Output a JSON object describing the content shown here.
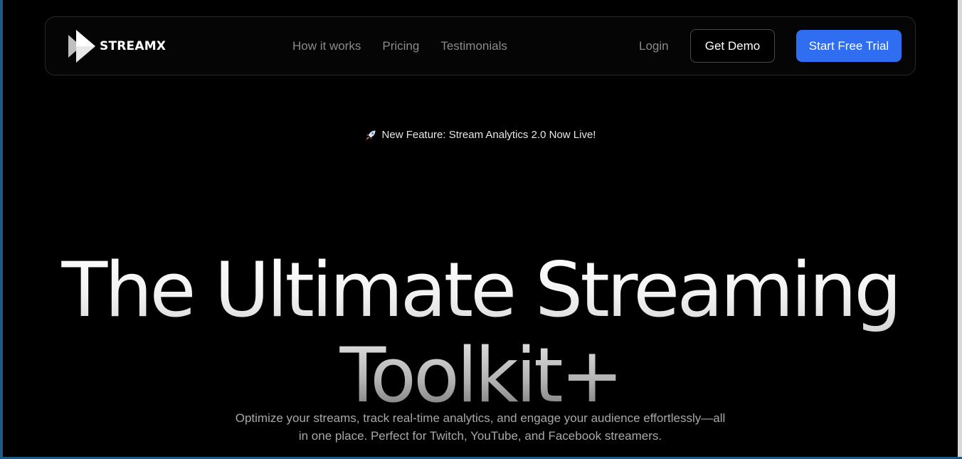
{
  "nav": {
    "brand": "STREAMX",
    "links": [
      "How it works",
      "Pricing",
      "Testimonials"
    ],
    "login": "Login",
    "demo_button": "Get Demo",
    "trial_button": "Start Free Trial"
  },
  "announcement": {
    "text": "New Feature: Stream Analytics 2.0 Now Live!",
    "icon": "rocket-icon"
  },
  "hero": {
    "headline_line1": "The Ultimate Streaming",
    "headline_line2": "Toolkit+",
    "subtext": "Optimize your streams, track real-time analytics, and engage your audience effortlessly—all in one place. Perfect for Twitch, YouTube, and Facebook streamers."
  },
  "colors": {
    "background": "#000000",
    "accent": "#2f6ef0",
    "muted_text": "#8b8b8b"
  }
}
